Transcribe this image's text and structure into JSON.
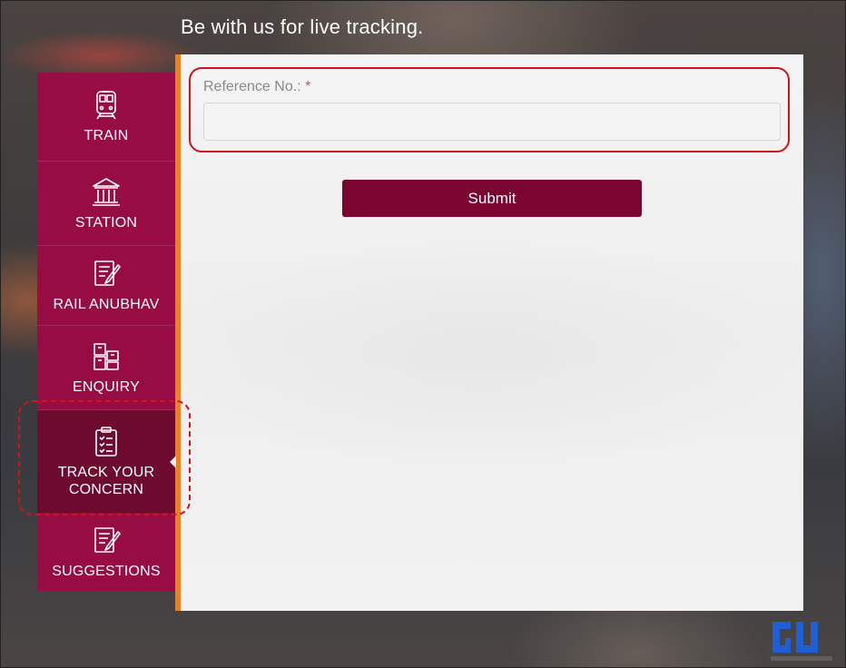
{
  "header": {
    "tagline": "Be with us for live tracking."
  },
  "sidebar": {
    "items": [
      {
        "label": "TRAIN",
        "icon": "train-icon"
      },
      {
        "label": "STATION",
        "icon": "station-building-icon"
      },
      {
        "label": "RAIL ANUBHAV",
        "icon": "feedback-form-icon"
      },
      {
        "label": "ENQUIRY",
        "icon": "enquiry-boxes-icon"
      },
      {
        "label": "TRACK YOUR CONCERN",
        "icon": "clipboard-checklist-icon",
        "active": true
      },
      {
        "label": "SUGGESTIONS",
        "icon": "suggestion-form-icon"
      }
    ]
  },
  "form": {
    "reference_label": "Reference No.:",
    "required_mark": "*",
    "reference_value": "",
    "submit_label": "Submit"
  },
  "colors": {
    "sidebar": "#970c42",
    "sidebar_active": "#6e0a2e",
    "submit": "#7a0530",
    "accent_border": "#f07f1e",
    "highlight": "#d0141a"
  },
  "watermark": {
    "icon": "gadgets-to-use-logo-icon"
  }
}
